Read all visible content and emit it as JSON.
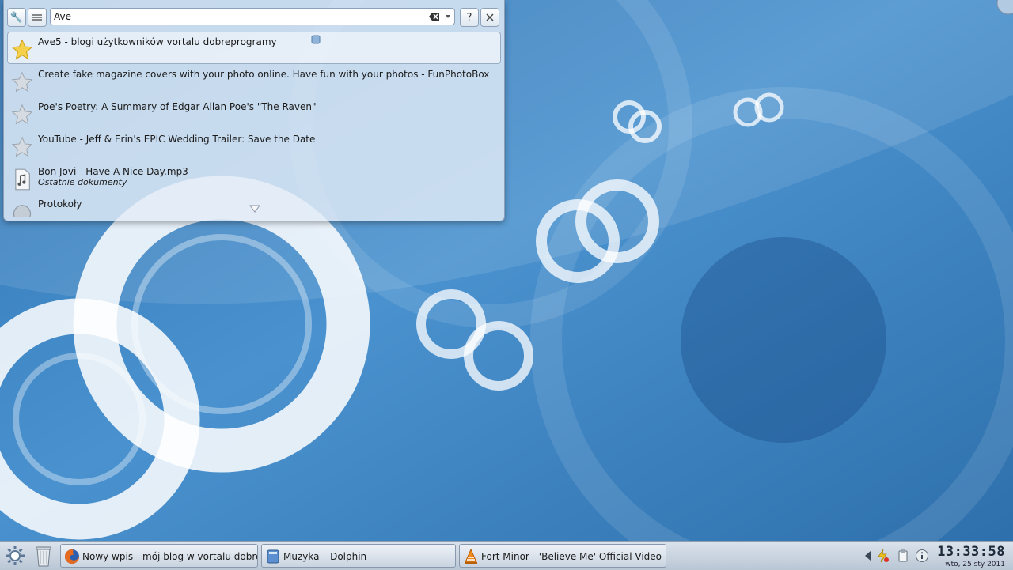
{
  "runner": {
    "query": "Ave",
    "help_label": "?",
    "results": [
      {
        "title": "Ave5 - blogi użytkowników vortalu dobreprogramy",
        "subtitle": "",
        "icon": "star-gold-icon"
      },
      {
        "title": "Create fake magazine covers with your photo online. Have fun with your photos - FunPhotoBox",
        "subtitle": "",
        "icon": "star-grey-icon"
      },
      {
        "title": "Poe's Poetry: A Summary of Edgar Allan Poe's \"The Raven\"",
        "subtitle": "",
        "icon": "star-grey-icon"
      },
      {
        "title": "YouTube - Jeff & Erin's EPIC Wedding Trailer: Save the Date",
        "subtitle": "",
        "icon": "star-grey-icon"
      },
      {
        "title": "Bon Jovi - Have A Nice Day.mp3",
        "subtitle": "Ostatnie dokumenty",
        "icon": "audio-file-icon"
      },
      {
        "title": "Protokoły",
        "subtitle": "",
        "icon": "protocol-icon"
      }
    ]
  },
  "taskbar": {
    "tasks": [
      {
        "label": "Nowy wpis - mój blog w vortalu dobreprogramy",
        "icon": "firefox-icon"
      },
      {
        "label": "Muzyka – Dolphin",
        "icon": "dolphin-icon"
      },
      {
        "label": "Fort Minor - 'Believe Me' Official Video",
        "icon": "vlc-icon"
      }
    ],
    "clock_time": "13:33:58",
    "clock_date": "wto, 25 sty 2011"
  },
  "colors": {
    "desktop_blue": "#3f86c4",
    "runner_bg": "#e2ecf6",
    "taskbar_bg": "#c9d4e0"
  }
}
